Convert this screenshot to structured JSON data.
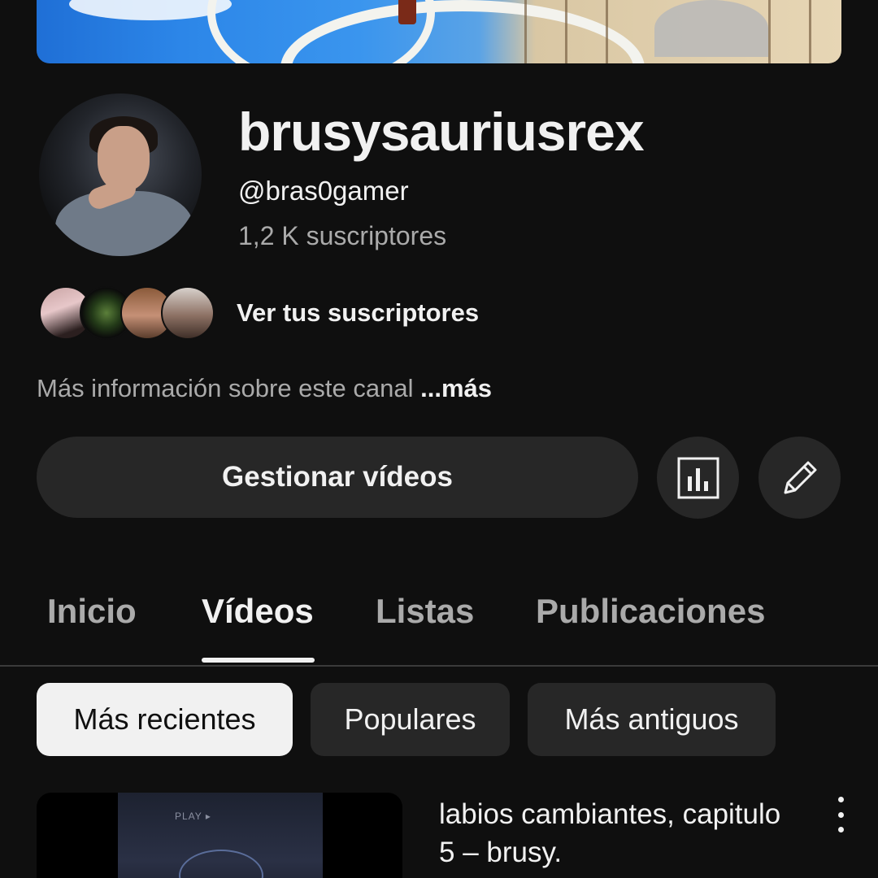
{
  "channel": {
    "name": "brusysauriusrex",
    "handle": "@bras0gamer",
    "subscribers": "1,2 K suscriptores",
    "view_subscribers": "Ver tus suscriptores",
    "more_info": "Más información sobre este canal",
    "more_link": "...más"
  },
  "actions": {
    "manage_videos": "Gestionar vídeos",
    "stats_icon": "analytics-icon",
    "edit_icon": "pencil-icon"
  },
  "tabs": [
    {
      "label": "Inicio",
      "selected": false
    },
    {
      "label": "Vídeos",
      "selected": true
    },
    {
      "label": "Listas",
      "selected": false
    },
    {
      "label": "Publicaciones",
      "selected": false
    }
  ],
  "filters": [
    {
      "label": "Más recientes",
      "selected": true
    },
    {
      "label": "Populares",
      "selected": false
    },
    {
      "label": "Más antiguos",
      "selected": false
    }
  ],
  "videos": [
    {
      "title": "labios cambiantes, capitulo 5 – brusy.",
      "thumb_text": "PLAY ▸"
    }
  ],
  "colors": {
    "background": "#0f0f0f",
    "surface": "#272727",
    "text": "#f1f1f1",
    "muted": "#aaaaaa"
  }
}
